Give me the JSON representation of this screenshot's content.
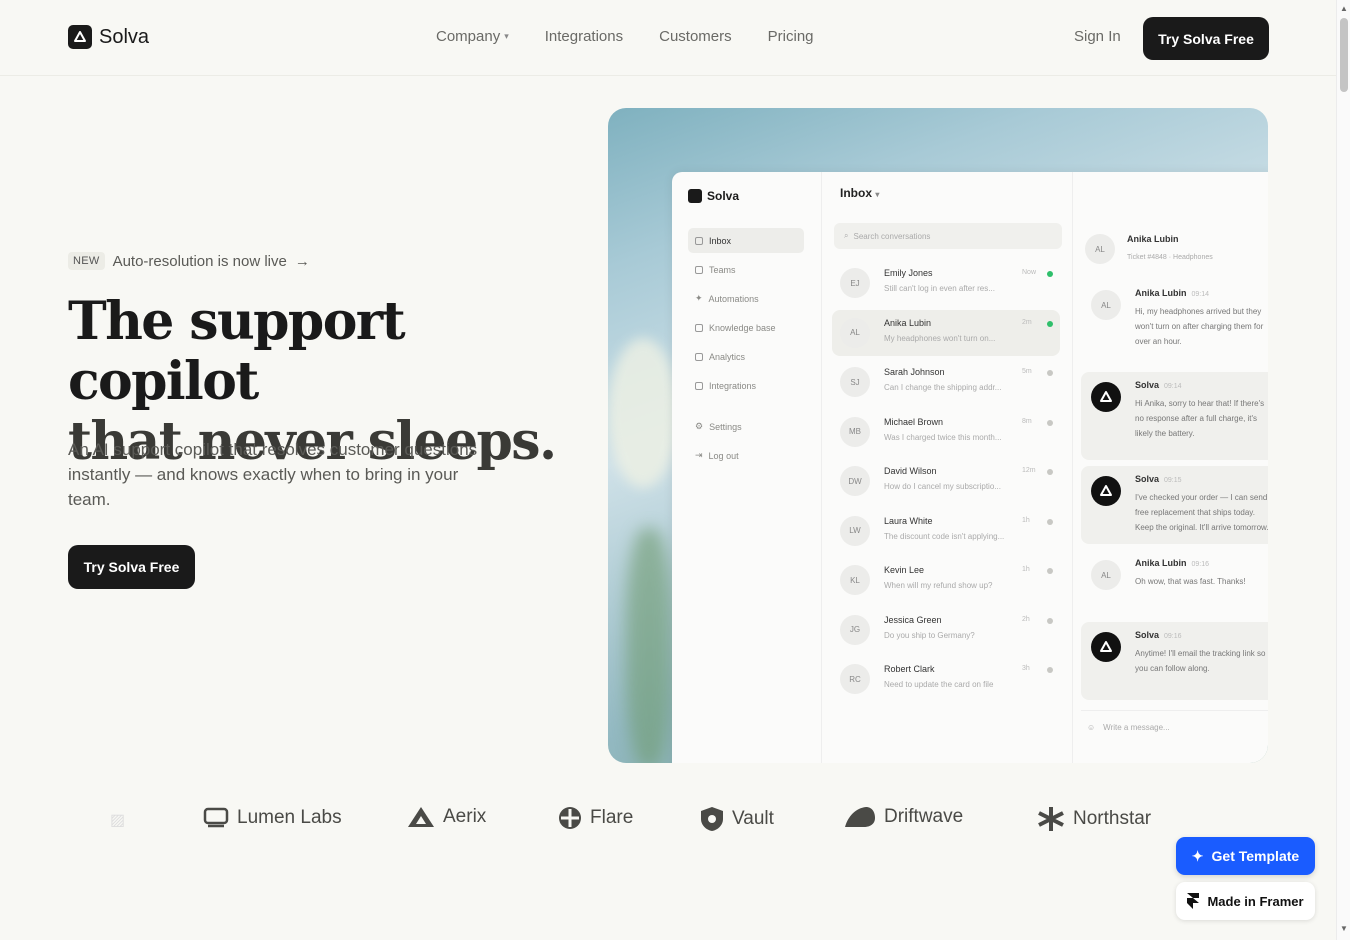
{
  "nav": {
    "brand": "Solva",
    "links": [
      "Company",
      "Integrations",
      "Customers",
      "Pricing"
    ],
    "sign_in": "Sign In",
    "cta": "Try Solva Free"
  },
  "hero": {
    "badge": "NEW",
    "announcement": "Auto-resolution is now live",
    "title_line1": "The support copilot",
    "title_line2": "that never sleeps.",
    "subtitle": "An AI support copilot that resolves customer questions instantly — and knows exactly when to bring in your team.",
    "cta": "Try Solva Free"
  },
  "app": {
    "brand": "Solva",
    "sidebar": [
      "Inbox",
      "Teams",
      "Automations",
      "Knowledge base",
      "Analytics",
      "Integrations"
    ],
    "sidebar_bottom": [
      "Settings",
      "Log out"
    ],
    "inbox_title": "Inbox",
    "search_placeholder": "Search conversations",
    "conversations": [
      {
        "initials": "EJ",
        "name": "Emily Jones",
        "preview": "Still can't log in even after res...",
        "time": "Now",
        "unread": true
      },
      {
        "initials": "AL",
        "name": "Anika Lubin",
        "preview": "My headphones won't turn on...",
        "time": "2m",
        "unread": true
      },
      {
        "initials": "SJ",
        "name": "Sarah Johnson",
        "preview": "Can I change the shipping addr...",
        "time": "5m",
        "unread": false
      },
      {
        "initials": "MB",
        "name": "Michael Brown",
        "preview": "Was I charged twice this month...",
        "time": "8m",
        "unread": false
      },
      {
        "initials": "DW",
        "name": "David Wilson",
        "preview": "How do I cancel my subscriptio...",
        "time": "12m",
        "unread": false
      },
      {
        "initials": "LW",
        "name": "Laura White",
        "preview": "The discount code isn't applying...",
        "time": "1h",
        "unread": false
      },
      {
        "initials": "KL",
        "name": "Kevin Lee",
        "preview": "When will my refund show up?",
        "time": "1h",
        "unread": false
      },
      {
        "initials": "JG",
        "name": "Jessica Green",
        "preview": "Do you ship to Germany?",
        "time": "2h",
        "unread": false
      },
      {
        "initials": "RC",
        "name": "Robert Clark",
        "preview": "Need to update the card on file",
        "time": "3h",
        "unread": false
      }
    ],
    "chat": {
      "name": "Anika Lubin",
      "initials": "AL",
      "meta": "Ticket #4848 · Headphones",
      "messages": [
        {
          "from": "Anika Lubin",
          "initials": "AL",
          "time": "09:14",
          "ai": false,
          "text": "Hi, my headphones arrived but they won't turn on after charging them for over an hour."
        },
        {
          "from": "Solva",
          "initials": "",
          "time": "09:14",
          "ai": true,
          "text": "Hi Anika, sorry to hear that! If there's no response after a full charge, it's likely the battery."
        },
        {
          "from": "Solva",
          "initials": "",
          "time": "09:15",
          "ai": true,
          "text": "I've checked your order — I can send a free replacement that ships today. Keep the original. It'll arrive tomorrow."
        },
        {
          "from": "Anika Lubin",
          "initials": "AL",
          "time": "09:16",
          "ai": false,
          "text": "Oh wow, that was fast. Thanks!"
        },
        {
          "from": "Solva",
          "initials": "",
          "time": "09:16",
          "ai": true,
          "text": "Anytime! I'll email the tracking link so you can follow along."
        }
      ],
      "compose_placeholder": "Write a message..."
    }
  },
  "logos": [
    "Lumen Labs",
    "Aerix",
    "Flare",
    "Vault",
    "Driftwave",
    "Northstar"
  ],
  "floating": {
    "template": "Get Template",
    "framer": "Made in Framer"
  },
  "colors": {
    "accent_blue": "#1a5cff",
    "ink": "#1a1a1a",
    "page_bg": "#f8f8f4",
    "online": "#2fbf6b"
  }
}
